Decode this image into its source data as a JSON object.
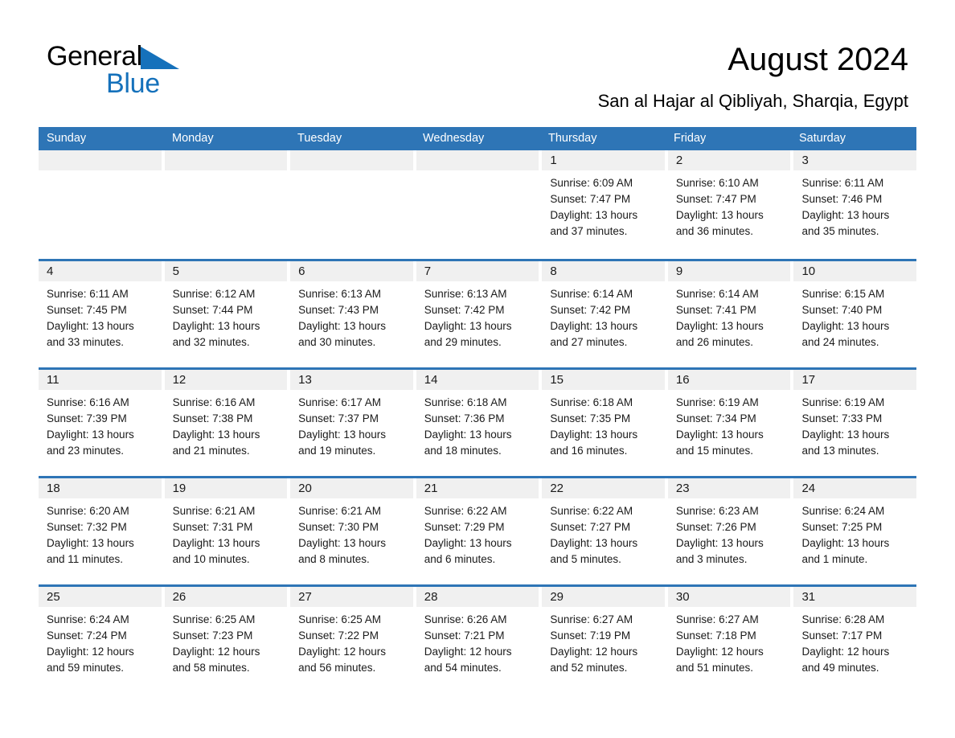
{
  "brand": {
    "word1": "General",
    "word2": "Blue",
    "triangle_color": "#1571bb",
    "word1_color": "#000000",
    "word2_color": "#1571bb"
  },
  "header": {
    "title": "August 2024",
    "subtitle": "San al Hajar al Qibliyah, Sharqia, Egypt"
  },
  "theme": {
    "header_bar": "#2e75b6",
    "row_divider": "#2e75b6",
    "day_band": "#f0f0f0",
    "page_bg": "#ffffff"
  },
  "weekdays": [
    "Sunday",
    "Monday",
    "Tuesday",
    "Wednesday",
    "Thursday",
    "Friday",
    "Saturday"
  ],
  "weeks": [
    [
      {
        "day": "",
        "sunrise": "",
        "sunset": "",
        "daylight1": "",
        "daylight2": ""
      },
      {
        "day": "",
        "sunrise": "",
        "sunset": "",
        "daylight1": "",
        "daylight2": ""
      },
      {
        "day": "",
        "sunrise": "",
        "sunset": "",
        "daylight1": "",
        "daylight2": ""
      },
      {
        "day": "",
        "sunrise": "",
        "sunset": "",
        "daylight1": "",
        "daylight2": ""
      },
      {
        "day": "1",
        "sunrise": "Sunrise: 6:09 AM",
        "sunset": "Sunset: 7:47 PM",
        "daylight1": "Daylight: 13 hours",
        "daylight2": "and 37 minutes."
      },
      {
        "day": "2",
        "sunrise": "Sunrise: 6:10 AM",
        "sunset": "Sunset: 7:47 PM",
        "daylight1": "Daylight: 13 hours",
        "daylight2": "and 36 minutes."
      },
      {
        "day": "3",
        "sunrise": "Sunrise: 6:11 AM",
        "sunset": "Sunset: 7:46 PM",
        "daylight1": "Daylight: 13 hours",
        "daylight2": "and 35 minutes."
      }
    ],
    [
      {
        "day": "4",
        "sunrise": "Sunrise: 6:11 AM",
        "sunset": "Sunset: 7:45 PM",
        "daylight1": "Daylight: 13 hours",
        "daylight2": "and 33 minutes."
      },
      {
        "day": "5",
        "sunrise": "Sunrise: 6:12 AM",
        "sunset": "Sunset: 7:44 PM",
        "daylight1": "Daylight: 13 hours",
        "daylight2": "and 32 minutes."
      },
      {
        "day": "6",
        "sunrise": "Sunrise: 6:13 AM",
        "sunset": "Sunset: 7:43 PM",
        "daylight1": "Daylight: 13 hours",
        "daylight2": "and 30 minutes."
      },
      {
        "day": "7",
        "sunrise": "Sunrise: 6:13 AM",
        "sunset": "Sunset: 7:42 PM",
        "daylight1": "Daylight: 13 hours",
        "daylight2": "and 29 minutes."
      },
      {
        "day": "8",
        "sunrise": "Sunrise: 6:14 AM",
        "sunset": "Sunset: 7:42 PM",
        "daylight1": "Daylight: 13 hours",
        "daylight2": "and 27 minutes."
      },
      {
        "day": "9",
        "sunrise": "Sunrise: 6:14 AM",
        "sunset": "Sunset: 7:41 PM",
        "daylight1": "Daylight: 13 hours",
        "daylight2": "and 26 minutes."
      },
      {
        "day": "10",
        "sunrise": "Sunrise: 6:15 AM",
        "sunset": "Sunset: 7:40 PM",
        "daylight1": "Daylight: 13 hours",
        "daylight2": "and 24 minutes."
      }
    ],
    [
      {
        "day": "11",
        "sunrise": "Sunrise: 6:16 AM",
        "sunset": "Sunset: 7:39 PM",
        "daylight1": "Daylight: 13 hours",
        "daylight2": "and 23 minutes."
      },
      {
        "day": "12",
        "sunrise": "Sunrise: 6:16 AM",
        "sunset": "Sunset: 7:38 PM",
        "daylight1": "Daylight: 13 hours",
        "daylight2": "and 21 minutes."
      },
      {
        "day": "13",
        "sunrise": "Sunrise: 6:17 AM",
        "sunset": "Sunset: 7:37 PM",
        "daylight1": "Daylight: 13 hours",
        "daylight2": "and 19 minutes."
      },
      {
        "day": "14",
        "sunrise": "Sunrise: 6:18 AM",
        "sunset": "Sunset: 7:36 PM",
        "daylight1": "Daylight: 13 hours",
        "daylight2": "and 18 minutes."
      },
      {
        "day": "15",
        "sunrise": "Sunrise: 6:18 AM",
        "sunset": "Sunset: 7:35 PM",
        "daylight1": "Daylight: 13 hours",
        "daylight2": "and 16 minutes."
      },
      {
        "day": "16",
        "sunrise": "Sunrise: 6:19 AM",
        "sunset": "Sunset: 7:34 PM",
        "daylight1": "Daylight: 13 hours",
        "daylight2": "and 15 minutes."
      },
      {
        "day": "17",
        "sunrise": "Sunrise: 6:19 AM",
        "sunset": "Sunset: 7:33 PM",
        "daylight1": "Daylight: 13 hours",
        "daylight2": "and 13 minutes."
      }
    ],
    [
      {
        "day": "18",
        "sunrise": "Sunrise: 6:20 AM",
        "sunset": "Sunset: 7:32 PM",
        "daylight1": "Daylight: 13 hours",
        "daylight2": "and 11 minutes."
      },
      {
        "day": "19",
        "sunrise": "Sunrise: 6:21 AM",
        "sunset": "Sunset: 7:31 PM",
        "daylight1": "Daylight: 13 hours",
        "daylight2": "and 10 minutes."
      },
      {
        "day": "20",
        "sunrise": "Sunrise: 6:21 AM",
        "sunset": "Sunset: 7:30 PM",
        "daylight1": "Daylight: 13 hours",
        "daylight2": "and 8 minutes."
      },
      {
        "day": "21",
        "sunrise": "Sunrise: 6:22 AM",
        "sunset": "Sunset: 7:29 PM",
        "daylight1": "Daylight: 13 hours",
        "daylight2": "and 6 minutes."
      },
      {
        "day": "22",
        "sunrise": "Sunrise: 6:22 AM",
        "sunset": "Sunset: 7:27 PM",
        "daylight1": "Daylight: 13 hours",
        "daylight2": "and 5 minutes."
      },
      {
        "day": "23",
        "sunrise": "Sunrise: 6:23 AM",
        "sunset": "Sunset: 7:26 PM",
        "daylight1": "Daylight: 13 hours",
        "daylight2": "and 3 minutes."
      },
      {
        "day": "24",
        "sunrise": "Sunrise: 6:24 AM",
        "sunset": "Sunset: 7:25 PM",
        "daylight1": "Daylight: 13 hours",
        "daylight2": "and 1 minute."
      }
    ],
    [
      {
        "day": "25",
        "sunrise": "Sunrise: 6:24 AM",
        "sunset": "Sunset: 7:24 PM",
        "daylight1": "Daylight: 12 hours",
        "daylight2": "and 59 minutes."
      },
      {
        "day": "26",
        "sunrise": "Sunrise: 6:25 AM",
        "sunset": "Sunset: 7:23 PM",
        "daylight1": "Daylight: 12 hours",
        "daylight2": "and 58 minutes."
      },
      {
        "day": "27",
        "sunrise": "Sunrise: 6:25 AM",
        "sunset": "Sunset: 7:22 PM",
        "daylight1": "Daylight: 12 hours",
        "daylight2": "and 56 minutes."
      },
      {
        "day": "28",
        "sunrise": "Sunrise: 6:26 AM",
        "sunset": "Sunset: 7:21 PM",
        "daylight1": "Daylight: 12 hours",
        "daylight2": "and 54 minutes."
      },
      {
        "day": "29",
        "sunrise": "Sunrise: 6:27 AM",
        "sunset": "Sunset: 7:19 PM",
        "daylight1": "Daylight: 12 hours",
        "daylight2": "and 52 minutes."
      },
      {
        "day": "30",
        "sunrise": "Sunrise: 6:27 AM",
        "sunset": "Sunset: 7:18 PM",
        "daylight1": "Daylight: 12 hours",
        "daylight2": "and 51 minutes."
      },
      {
        "day": "31",
        "sunrise": "Sunrise: 6:28 AM",
        "sunset": "Sunset: 7:17 PM",
        "daylight1": "Daylight: 12 hours",
        "daylight2": "and 49 minutes."
      }
    ]
  ]
}
